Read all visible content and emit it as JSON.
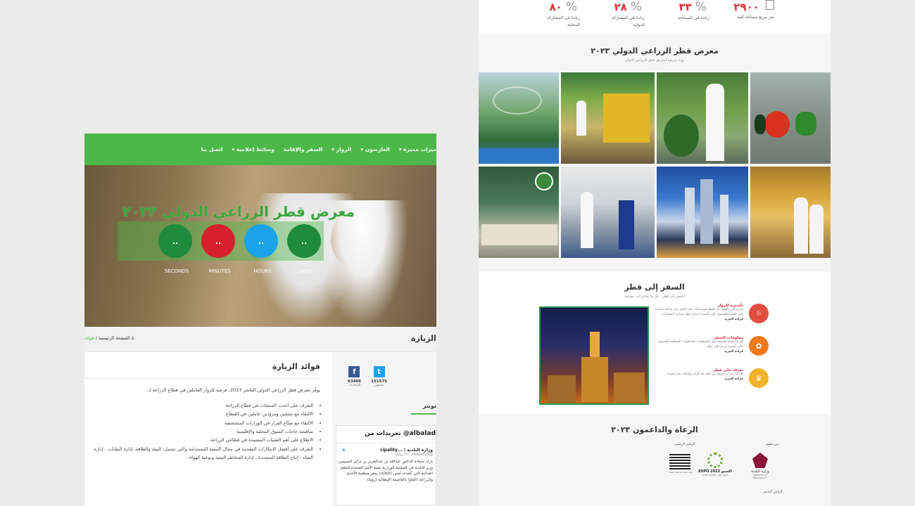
{
  "stats": [
    {
      "value": "٢٩٠٠",
      "pct": "",
      "label1": "متر مربع مساحة كلية",
      "label2": ""
    },
    {
      "value": "٣٣",
      "pct": "%",
      "label1": "زيادة في المساحة",
      "label2": ""
    },
    {
      "value": "٢٨",
      "pct": "%",
      "label1": "زيادة في المشاركة",
      "label2": "الدولية"
    },
    {
      "value": "٨٠",
      "pct": "%",
      "label1": "زيادة في المشاركة",
      "label2": "المحلية"
    }
  ],
  "gallery": {
    "title": "معرض قطر الزراعي الدولي ٢٠٢٣",
    "subtitle": "رؤية سريعة لمعرض قطر الزراعي الدولي"
  },
  "travel": {
    "title": "السفر إلى قطر",
    "subtitle": "السفر إلى قطر.. كل ما يحتاج إلى معرفته",
    "items": [
      {
        "title": "تأشيرة للزوار",
        "desc": "يجري الآن بالعمل أن تقطع سوساعات على الدول عي وعاءة ساعده على النقدم للحصول على تأشيرة لزيارة قطر وتدابير السعادات",
        "more": "قراءة المزيد"
      },
      {
        "title": "معلومات السفر",
        "desc": "كل ما تحتاج معرفته حول المتطلبات والخطوات المختلفة للحصول على تأشيرة لزيارة إلى قطر",
        "more": "قراءة المزيد"
      },
      {
        "title": "تعرف على قطر",
        "desc": "كل ما تريد أن تعرفه عن البلد بلد الزائر وأماكنه عدا سعيدة",
        "more": "قراءة المزيد"
      }
    ]
  },
  "sponsors": {
    "title": "الرعاة والداعمون ٢٠٢٣",
    "label_org": "من تنظيم",
    "label_official": "الراعي الرسمي",
    "label_support": "الراعي الداعم",
    "expo_label": "EXPO 2023 اكسبو",
    "expo_sub": "DOHA QATAR | الدوحة قطر",
    "ministry_label": "وزارة البلدية",
    "ministry_sub": "MINISTRY OF MUNICIPALITY",
    "pwa_label": "Public Works Authority"
  },
  "nav": {
    "items": [
      "ميزات مميزة",
      "العارضون",
      "الزوار",
      "السفر والإقامة",
      "وسائط إعلامية",
      "اتصل بنا"
    ]
  },
  "hero": {
    "title": "معرض قطر الزراعي الدولي ٢٠٢٣",
    "countdown": [
      {
        "value": "..",
        "label": "DAYS",
        "color": "#1e8a3c"
      },
      {
        "value": "..",
        "label": "HOURS",
        "color": "#1aa3e8"
      },
      {
        "value": "..",
        "label": "MINUTES",
        "color": "#d6202b"
      },
      {
        "value": "..",
        "label": "SECONDS",
        "color": "#1e8a3c"
      }
    ]
  },
  "breadcrumb": {
    "page_heading": "فوائد الزيارة",
    "home": "الصفحة الرئيسية",
    "sep": "/",
    "current": "فوائد"
  },
  "benefits": {
    "title": "فوائد الزيارة",
    "intro": "يوفّر معرض قطر الزراعي الدولي العاشر 2023، فرصة للزوار العاملين في قطاع الزراعة لـ:",
    "items": [
      "التعرف على أحدث المنتجات في قطاع الزراعة",
      "الالتقاء مع منتجين ومزوّدين عاملين في القطاع",
      "الالتقاء مع صنّاع القرار في الوزارات المتخصصة",
      "مناقشة حاجات السوق المحلية والإقليمية",
      "الاطلاع على أهم التقنيات المعتمدة في قطاعي الزراعة",
      "التعرف على أفضل الابتكارات المقدمة في مجال التنمية المستدامة والتي تشمل: البيئة والطاقة، إدارة النفايات ، إدارة المياه ، إنتاج الطاقة المتجددة ، إدارة المخاطر البيئية ونوعية الهواء ."
    ]
  },
  "social": {
    "twitter_count": "151575",
    "twitter_label": "متابعون",
    "facebook_count": "63406",
    "facebook_label": "الإعجابات",
    "tab_label": "تويتر"
  },
  "tweets": {
    "header": "تغريدات من @albaladiya",
    "author": "وزارة البلدية | ...cipality",
    "handle": "@albaladiya · ٢٦ يوليو",
    "text": "بارك سعادة الدكتور عبدالله بن عبدالعزيز بن تركي السبيعي، وزير البلدية في الجلسة الوزارية بقمة الأمم المتحدة للنظم الغذائية التي عُقدت أمس (الثلاثاء) بمقر منظمة الأغذية والزراعة (الفاو) بالعاصمة الإيطالية (روما).",
    "link": "قراءة المزيد"
  },
  "colors": {
    "brand_green": "#4cb849",
    "accent_red": "#d6323e",
    "twitter_blue": "#1da1f2",
    "facebook_blue": "#3b5998"
  }
}
